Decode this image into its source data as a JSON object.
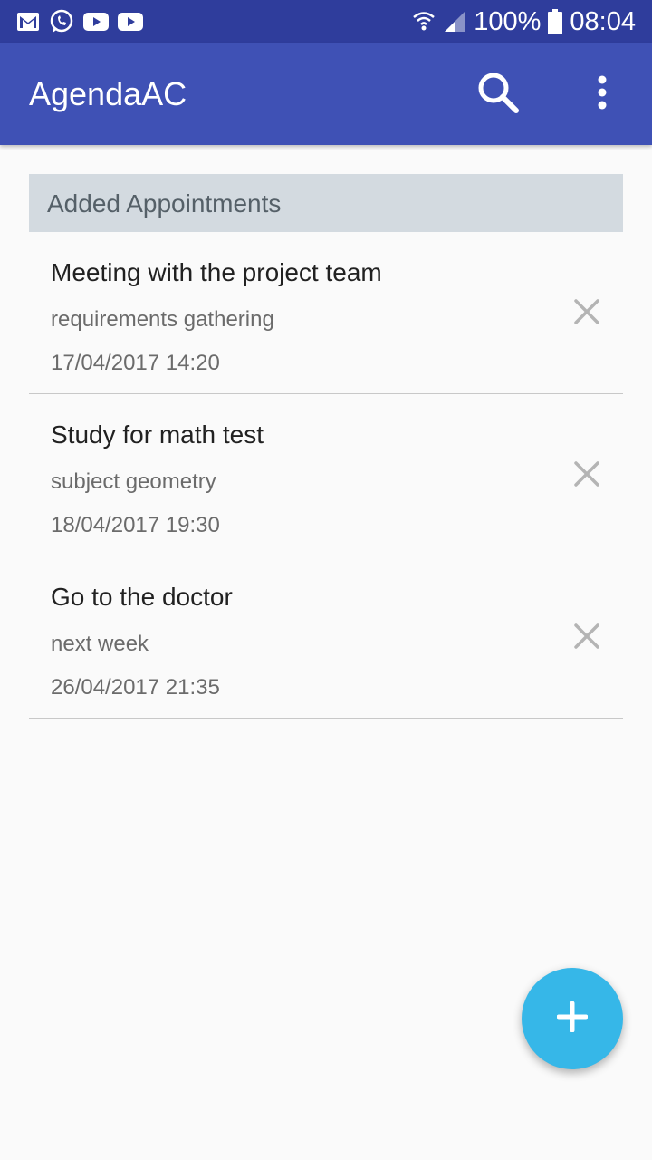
{
  "status_bar": {
    "left_icons": [
      "gmail-icon",
      "whatsapp-icon",
      "youtube-icon",
      "youtube-icon"
    ],
    "battery": "100%",
    "time": "08:04"
  },
  "app_bar": {
    "title": "AgendaAC",
    "actions": [
      "search-icon",
      "more-vert-icon"
    ]
  },
  "section": {
    "header": "Added Appointments"
  },
  "appointments": [
    {
      "title": "Meeting with the project team",
      "description": "requirements gathering",
      "datetime": "17/04/2017 14:20"
    },
    {
      "title": "Study for math test",
      "description": "subject geometry",
      "datetime": "18/04/2017 19:30"
    },
    {
      "title": "Go to the doctor",
      "description": "next week",
      "datetime": "26/04/2017 21:35"
    }
  ],
  "fab": {
    "icon": "add-icon"
  },
  "colors": {
    "status_bar": "#2f3d9c",
    "app_bar": "#3f51b5",
    "section_header": "#d3dae0",
    "fab": "#36b7e8"
  }
}
